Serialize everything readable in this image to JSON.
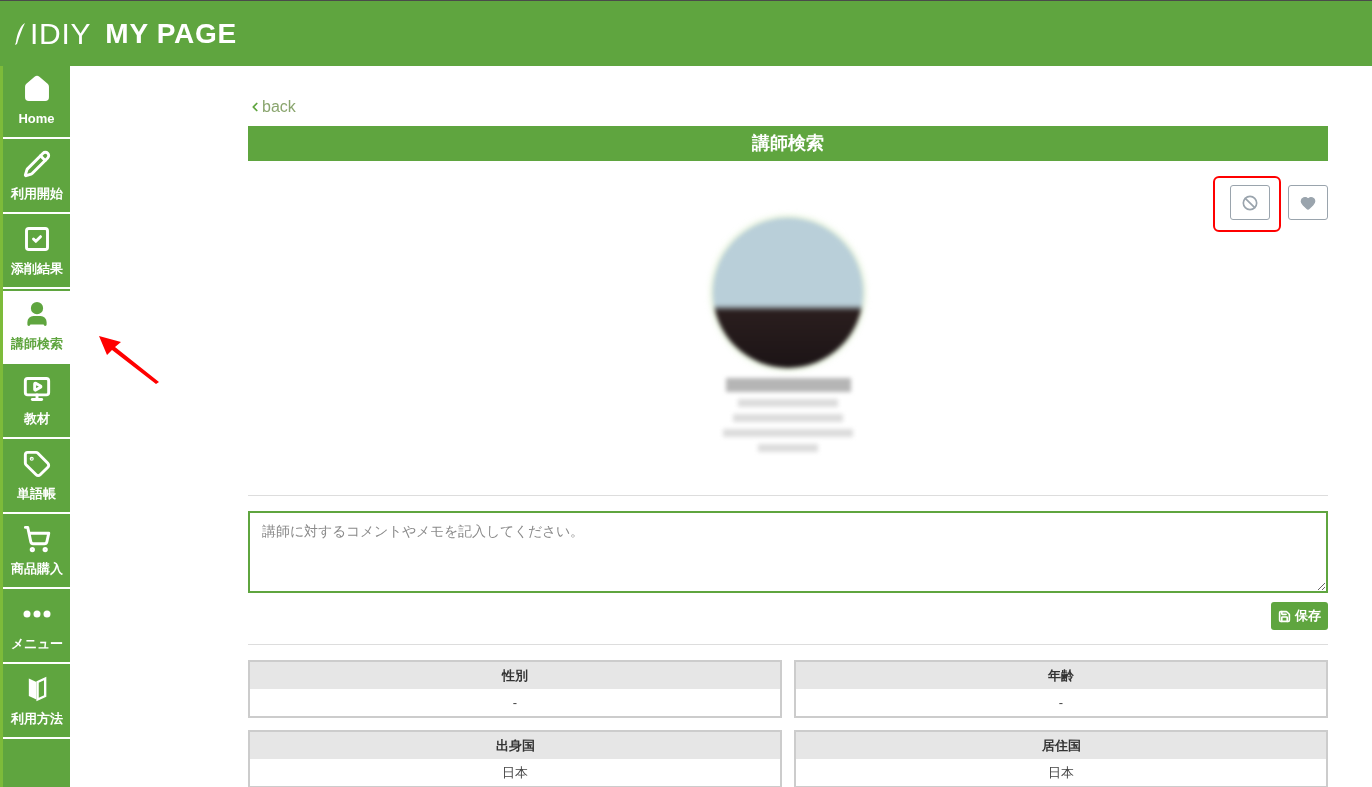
{
  "header": {
    "logo": "IDIY",
    "title": "MY PAGE"
  },
  "sidebar": {
    "items": [
      {
        "label": "Home",
        "selected": false
      },
      {
        "label": "利用開始",
        "selected": false
      },
      {
        "label": "添削結果",
        "selected": false
      },
      {
        "label": "講師検索",
        "selected": true
      },
      {
        "label": "教材",
        "selected": false
      },
      {
        "label": "単語帳",
        "selected": false
      },
      {
        "label": "商品購入",
        "selected": false
      },
      {
        "label": "メニュー",
        "selected": false
      },
      {
        "label": "利用方法",
        "selected": false
      }
    ]
  },
  "back_link": "back",
  "page_title": "講師検索",
  "memo": {
    "placeholder": "講師に対するコメントやメモを記入してください。"
  },
  "save_button": "保存",
  "info": [
    {
      "label": "性別",
      "value": "-"
    },
    {
      "label": "年齢",
      "value": "-"
    },
    {
      "label": "出身国",
      "value": "日本"
    },
    {
      "label": "居住国",
      "value": "日本"
    }
  ]
}
